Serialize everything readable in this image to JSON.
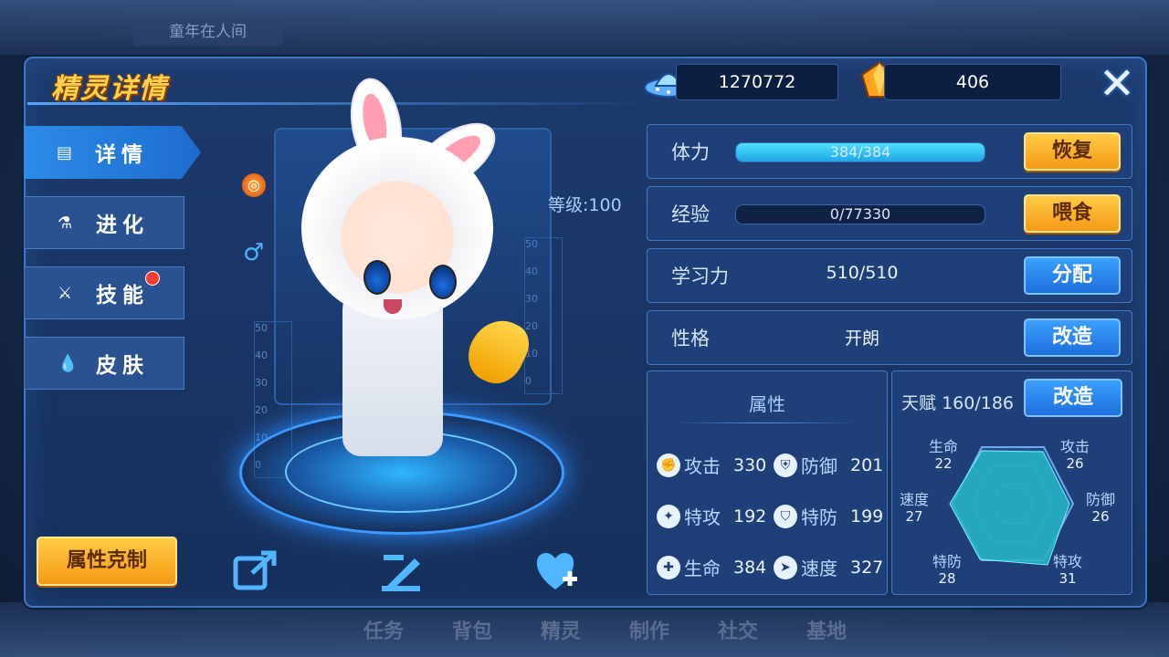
{
  "background": {
    "tab_label": "童年在人间",
    "bottom_nav": [
      "任务",
      "背包",
      "精灵",
      "制作",
      "社交",
      "基地"
    ]
  },
  "header": {
    "title": "精灵详情",
    "coins": "1270772",
    "gems": "406",
    "close_icon": "close-x-icon"
  },
  "sidebar": {
    "items": [
      {
        "label": "详情",
        "icon": "details-icon",
        "active": true
      },
      {
        "label": "进化",
        "icon": "flask-icon",
        "active": false
      },
      {
        "label": "技能",
        "icon": "sword-icon",
        "active": false,
        "badge": true
      },
      {
        "label": "皮肤",
        "icon": "drop-icon",
        "active": false
      }
    ],
    "type_button": "属性克制"
  },
  "pet": {
    "level_label": "等级:100",
    "gender": "♂",
    "gauge_ticks": [
      "50",
      "40",
      "30",
      "20",
      "10",
      "0"
    ]
  },
  "tools": {
    "share_icon": "share-icon",
    "rename_icon": "edit-icon",
    "favorite_icon": "heart-plus-icon"
  },
  "rows": {
    "stamina": {
      "label": "体力",
      "value": "384/384",
      "fill": 1.0,
      "button": "恢复"
    },
    "exp": {
      "label": "经验",
      "value": "0/77330",
      "fill": 0.0,
      "button": "喂食"
    },
    "learning": {
      "label": "学习力",
      "value": "510/510",
      "button": "分配"
    },
    "nature": {
      "label": "性格",
      "value": "开朗",
      "button": "改造"
    }
  },
  "attributes": {
    "title": "属性",
    "stats": [
      {
        "label": "攻击",
        "value": "330"
      },
      {
        "label": "防御",
        "value": "201"
      },
      {
        "label": "特攻",
        "value": "192"
      },
      {
        "label": "特防",
        "value": "199"
      },
      {
        "label": "生命",
        "value": "384"
      },
      {
        "label": "速度",
        "value": "327"
      }
    ]
  },
  "talent": {
    "label": "天赋",
    "value": "160/186",
    "button": "改造",
    "radar": [
      {
        "label": "生命",
        "value": "22"
      },
      {
        "label": "攻击",
        "value": "26"
      },
      {
        "label": "防御",
        "value": "26"
      },
      {
        "label": "特攻",
        "value": "31"
      },
      {
        "label": "特防",
        "value": "28"
      },
      {
        "label": "速度",
        "value": "27"
      }
    ]
  },
  "colors": {
    "accent_orange": "#f59a16",
    "accent_blue": "#1f6fdc",
    "panel": "#1f3f78",
    "bar_fill": "#1ea6e6",
    "title_gold": "#ffd24a"
  }
}
